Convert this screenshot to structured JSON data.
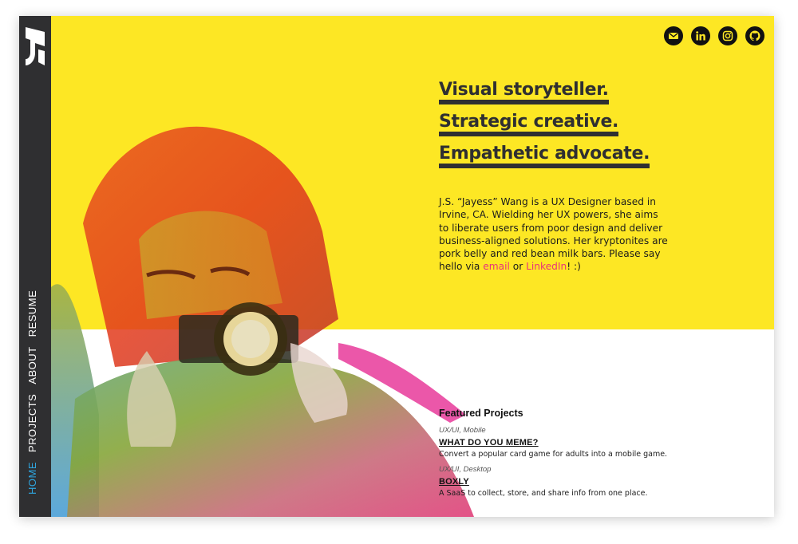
{
  "nav": {
    "items": [
      {
        "label": "HOME",
        "active": true
      },
      {
        "label": "PROJECTS",
        "active": false
      },
      {
        "label": "ABOUT",
        "active": false
      },
      {
        "label": "RESUME",
        "active": false
      }
    ]
  },
  "social": {
    "icons": [
      "email-icon",
      "linkedin-icon",
      "instagram-icon",
      "github-icon"
    ]
  },
  "hero": {
    "headlines": [
      "Visual storyteller.",
      "Strategic creative.",
      "Empathetic advocate."
    ],
    "bio_before": "J.S. “Jayess” Wang is a UX Designer based in Irvine, CA. Wielding her UX powers, she aims to liberate users from poor design and deliver business-aligned solutions. Her kryptonites are pork belly and red bean milk bars. Please say hello via ",
    "bio_email": "email",
    "bio_or": " or ",
    "bio_linkedin": "LinkedIn",
    "bio_after": "! :)"
  },
  "featured": {
    "heading": "Featured Projects",
    "projects": [
      {
        "category": "UX/UI, Mobile",
        "title": "WHAT DO YOU MEME?",
        "description": "Convert a popular card game for adults into a mobile game."
      },
      {
        "category": "UX/UI, Desktop",
        "title": "BOXLY",
        "description": "A SaaS to collect, store, and share info from one place."
      }
    ]
  },
  "colors": {
    "accent_yellow": "#fde724",
    "sidebar": "#2f2f31",
    "link_pink": "#e8347a",
    "nav_active": "#2fa6e0"
  }
}
